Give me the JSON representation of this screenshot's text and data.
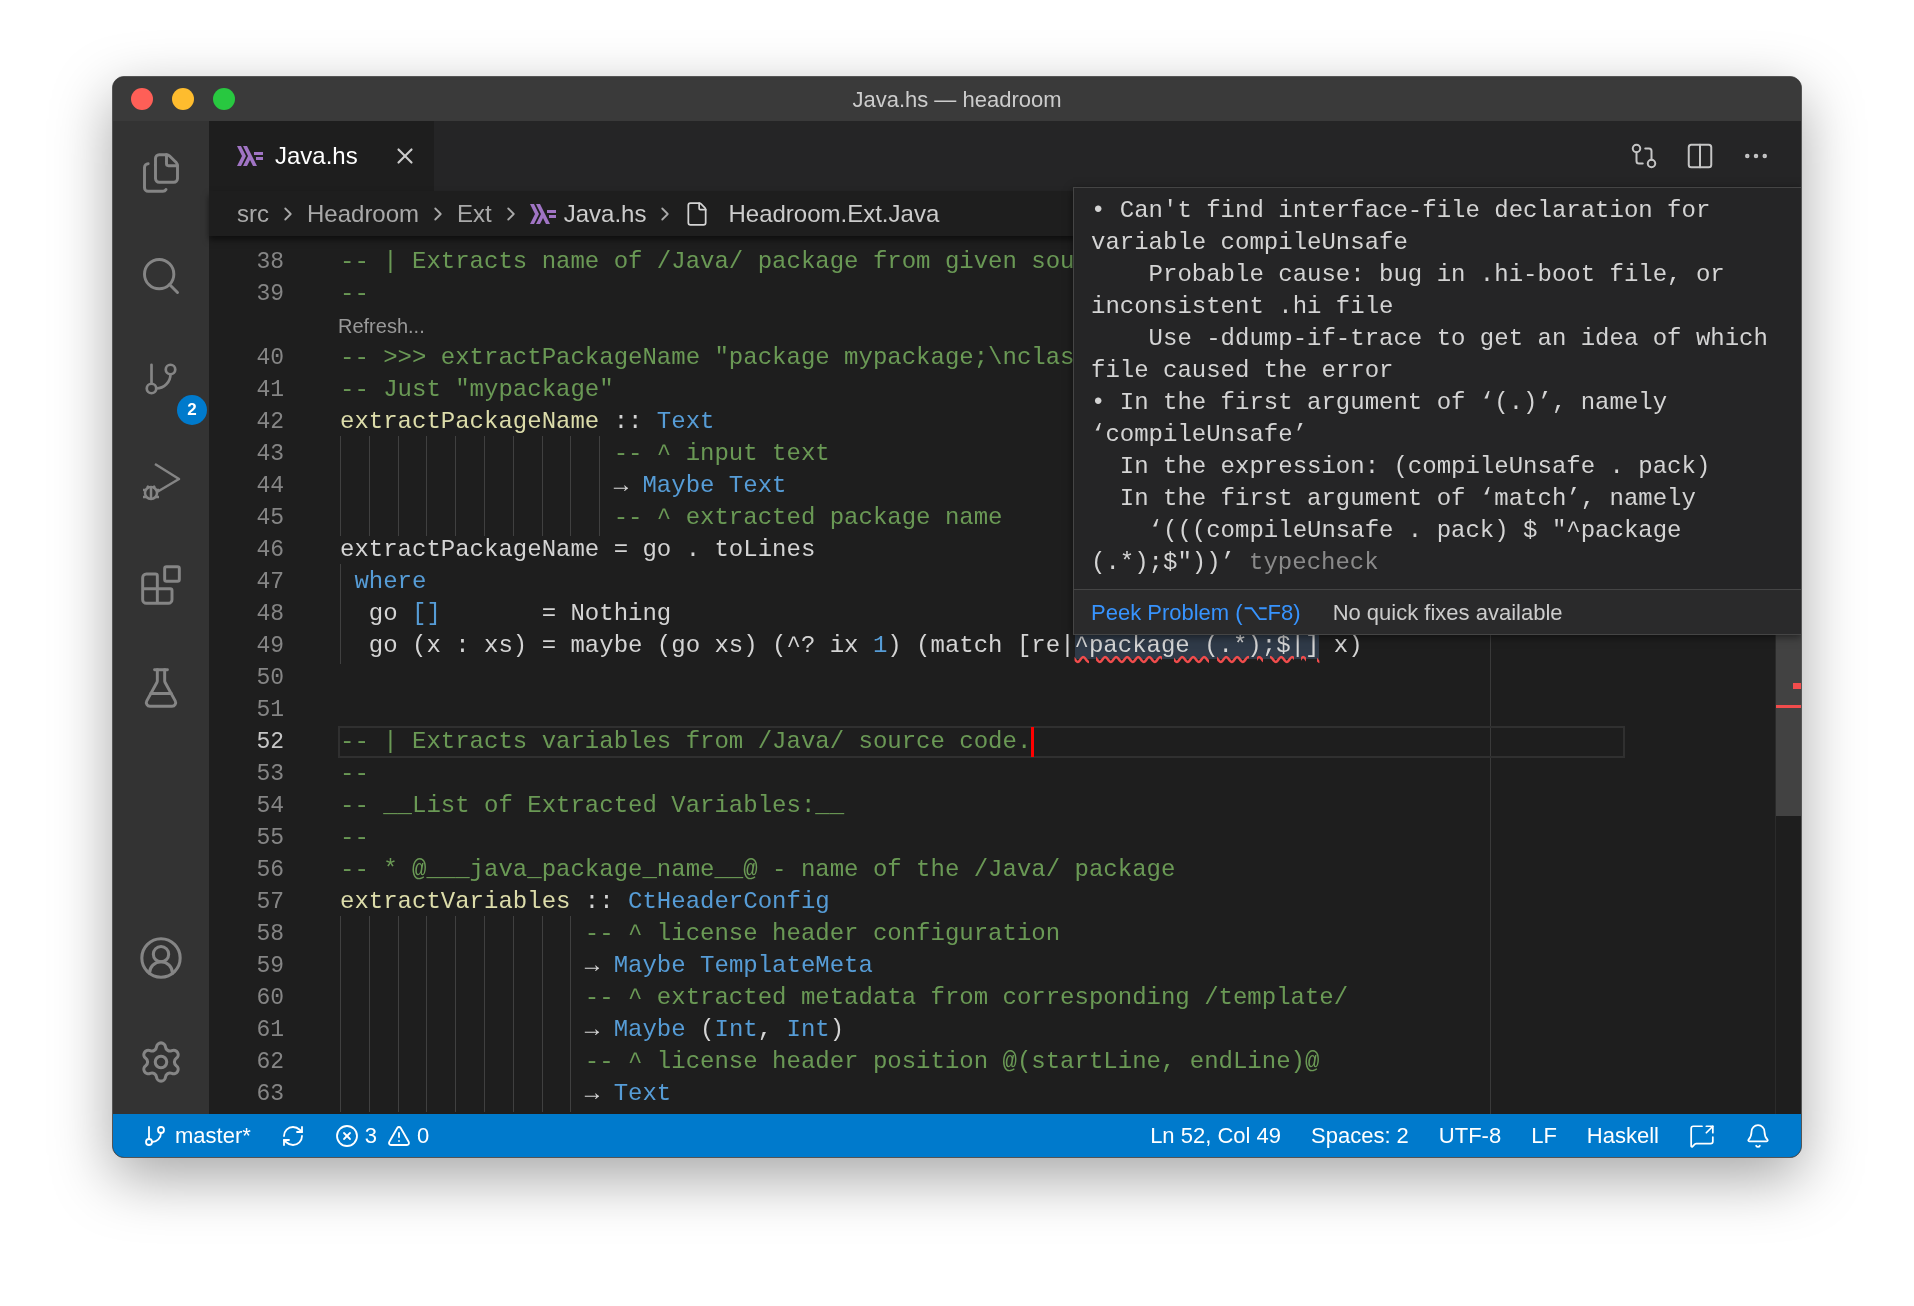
{
  "window": {
    "title": "Java.hs — headroom"
  },
  "activity_bar": {
    "source_control_badge": "2"
  },
  "tabs": [
    {
      "label": "Java.hs",
      "selected": true
    }
  ],
  "breadcrumbs": [
    {
      "label": "src",
      "kind": "folder"
    },
    {
      "label": "Headroom",
      "kind": "folder"
    },
    {
      "label": "Ext",
      "kind": "folder"
    },
    {
      "label": "Java.hs",
      "kind": "haskell"
    },
    {
      "label": "Headroom.Ext.Java",
      "kind": "module"
    }
  ],
  "editor": {
    "lines": [
      {
        "kind": "code",
        "number": "38",
        "current": false,
        "tokens": [
          {
            "kind": "comment",
            "text": "-- | Extracts name of /Java/ package from given sou"
          }
        ]
      },
      {
        "kind": "code",
        "number": "39",
        "current": false,
        "tokens": [
          {
            "kind": "comment",
            "text": "--"
          }
        ]
      },
      {
        "kind": "codelens",
        "text": "Refresh..."
      },
      {
        "kind": "code",
        "number": "40",
        "current": false,
        "tokens": [
          {
            "kind": "comment",
            "text": "-- >>> extractPackageName \"package mypackage;\\nclas"
          }
        ]
      },
      {
        "kind": "code",
        "number": "41",
        "current": false,
        "tokens": [
          {
            "kind": "comment",
            "text": "-- Just \"mypackage\""
          }
        ]
      },
      {
        "kind": "code",
        "number": "42",
        "current": false,
        "tokens": [
          {
            "kind": "func",
            "text": "extractPackageName"
          },
          {
            "kind": "plain",
            "text": " :: "
          },
          {
            "kind": "type",
            "text": "Text"
          }
        ]
      },
      {
        "kind": "code",
        "number": "43",
        "current": false,
        "tokens": [
          {
            "kind": "comment",
            "text": "                   -- ^ input text"
          }
        ]
      },
      {
        "kind": "code",
        "number": "44",
        "current": false,
        "tokens": [
          {
            "kind": "plain",
            "text": "                   → "
          },
          {
            "kind": "type",
            "text": "Maybe Text"
          }
        ]
      },
      {
        "kind": "code",
        "number": "45",
        "current": false,
        "tokens": [
          {
            "kind": "comment",
            "text": "                   -- ^ extracted package name"
          }
        ]
      },
      {
        "kind": "code",
        "number": "46",
        "current": false,
        "tokens": [
          {
            "kind": "plain",
            "text": "extractPackageName = go . toLines"
          }
        ]
      },
      {
        "kind": "code",
        "number": "47",
        "current": false,
        "tokens": [
          {
            "kind": "type",
            "text": " where"
          }
        ]
      },
      {
        "kind": "code",
        "number": "48",
        "current": false,
        "tokens": [
          {
            "kind": "plain",
            "text": "  go "
          },
          {
            "kind": "type",
            "text": "[]"
          },
          {
            "kind": "plain",
            "text": "       = Nothing"
          }
        ]
      },
      {
        "kind": "code",
        "number": "49",
        "current": false,
        "tokens": [
          {
            "kind": "plain",
            "text": "  go (x : xs) = maybe (go xs) (^? ix "
          },
          {
            "kind": "type",
            "text": "1"
          },
          {
            "kind": "plain",
            "text": ") (match [re|"
          },
          {
            "kind": "error",
            "text": "^package (.*);$|]"
          },
          {
            "kind": "plain",
            "text": " x)"
          }
        ]
      },
      {
        "kind": "code",
        "number": "50",
        "current": false
      },
      {
        "kind": "code",
        "number": "51",
        "current": false
      },
      {
        "kind": "code",
        "number": "52",
        "current": true,
        "tokens": [
          {
            "kind": "comment",
            "text": "-- | Extracts variables from /Java/ source code."
          }
        ]
      },
      {
        "kind": "code",
        "number": "53",
        "current": false,
        "tokens": [
          {
            "kind": "comment",
            "text": "--"
          }
        ]
      },
      {
        "kind": "code",
        "number": "54",
        "current": false,
        "tokens": [
          {
            "kind": "comment",
            "text": "-- __List of Extracted Variables:__"
          }
        ]
      },
      {
        "kind": "code",
        "number": "55",
        "current": false,
        "tokens": [
          {
            "kind": "comment",
            "text": "--"
          }
        ]
      },
      {
        "kind": "code",
        "number": "56",
        "current": false,
        "tokens": [
          {
            "kind": "comment",
            "text": "-- * @___java_package_name__@ - name of the /Java/ package"
          }
        ]
      },
      {
        "kind": "code",
        "number": "57",
        "current": false,
        "tokens": [
          {
            "kind": "func",
            "text": "extractVariables"
          },
          {
            "kind": "plain",
            "text": " :: "
          },
          {
            "kind": "type",
            "text": "CtHeaderConfig"
          }
        ]
      },
      {
        "kind": "code",
        "number": "58",
        "current": false,
        "tokens": [
          {
            "kind": "comment",
            "text": "                 -- ^ license header configuration"
          }
        ]
      },
      {
        "kind": "code",
        "number": "59",
        "current": false,
        "tokens": [
          {
            "kind": "plain",
            "text": "                 → "
          },
          {
            "kind": "type",
            "text": "Maybe TemplateMeta"
          }
        ]
      },
      {
        "kind": "code",
        "number": "60",
        "current": false,
        "tokens": [
          {
            "kind": "comment",
            "text": "                 -- ^ extracted metadata from corresponding /template/"
          }
        ]
      },
      {
        "kind": "code",
        "number": "61",
        "current": false,
        "tokens": [
          {
            "kind": "plain",
            "text": "                 → "
          },
          {
            "kind": "type",
            "text": "Maybe"
          },
          {
            "kind": "plain",
            "text": " ("
          },
          {
            "kind": "type",
            "text": "Int"
          },
          {
            "kind": "plain",
            "text": ", "
          },
          {
            "kind": "type",
            "text": "Int"
          },
          {
            "kind": "plain",
            "text": ")"
          }
        ]
      },
      {
        "kind": "code",
        "number": "62",
        "current": false,
        "tokens": [
          {
            "kind": "comment",
            "text": "                 -- ^ license header position @(startLine, endLine)@"
          }
        ]
      },
      {
        "kind": "code",
        "number": "63",
        "current": false,
        "tokens": [
          {
            "kind": "plain",
            "text": "                 → "
          },
          {
            "kind": "type",
            "text": "Text"
          }
        ]
      }
    ]
  },
  "hover": {
    "lines": [
      "• Can't find interface-file declaration for",
      "variable compileUnsafe",
      "    Probable cause: bug in .hi-boot file, or",
      "inconsistent .hi file",
      "    Use -ddump-if-trace to get an idea of which",
      "file caused the error",
      "• In the first argument of ‘(.)’, namely",
      "‘compileUnsafe’",
      "  In the expression: (compileUnsafe . pack)",
      "  In the first argument of ‘match’, namely",
      "    ‘(((compileUnsafe . pack) $ \"^package",
      "(.*);$\"))’"
    ],
    "source": "typecheck",
    "action": "Peek Problem (⌥F8)",
    "note": "No quick fixes available"
  },
  "status_bar": {
    "branch": "master*",
    "errors": "3",
    "warnings": "0",
    "items": [
      "Ln 52, Col 49",
      "Spaces: 2",
      "UTF-8",
      "LF",
      "Haskell"
    ]
  }
}
